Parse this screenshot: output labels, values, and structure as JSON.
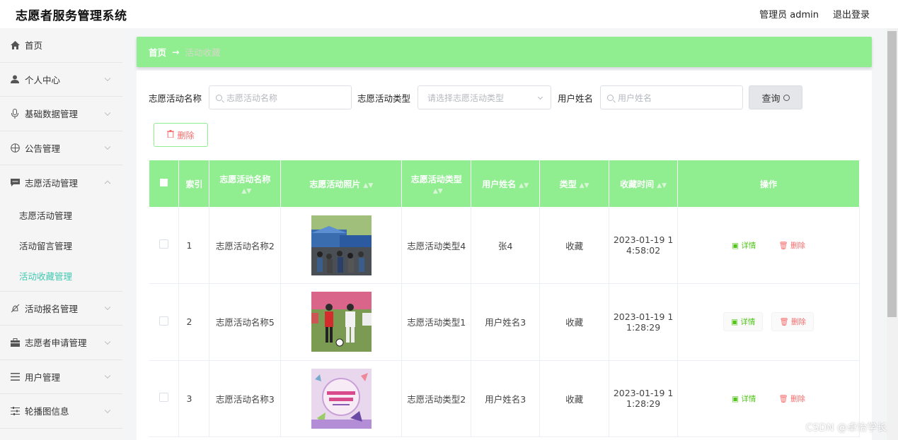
{
  "app": {
    "title": "志愿者服务管理系统",
    "user_label": "管理员 admin",
    "logout_label": "退出登录"
  },
  "sidebar": {
    "items": [
      {
        "label": "首页",
        "icon": "home-icon"
      },
      {
        "label": "个人中心",
        "icon": "user-icon"
      },
      {
        "label": "基础数据管理",
        "icon": "mic-icon"
      },
      {
        "label": "公告管理",
        "icon": "compass-icon"
      },
      {
        "label": "志愿活动管理",
        "icon": "chat-icon"
      },
      {
        "label": "活动报名管理",
        "icon": "bell-off-icon"
      },
      {
        "label": "志愿者申请管理",
        "icon": "briefcase-icon"
      },
      {
        "label": "用户管理",
        "icon": "menu-icon"
      },
      {
        "label": "轮播图信息",
        "icon": "sliders-icon"
      }
    ],
    "submenu": [
      {
        "label": "志愿活动管理"
      },
      {
        "label": "活动留言管理"
      },
      {
        "label": "活动收藏管理"
      }
    ]
  },
  "breadcrumb": {
    "home": "首页",
    "separator": "→",
    "current": "活动收藏"
  },
  "filters": {
    "name_label": "志愿活动名称",
    "name_placeholder": "志愿活动名称",
    "type_label": "志愿活动类型",
    "type_placeholder": "请选择志愿活动类型",
    "user_label": "用户姓名",
    "user_placeholder": "用户姓名",
    "query_label": "查询"
  },
  "toolbar": {
    "delete_label": "删除"
  },
  "table": {
    "headers": [
      "索引",
      "志愿活动名称",
      "志愿活动照片",
      "志愿活动类型",
      "用户姓名",
      "类型",
      "收藏时间",
      "操作"
    ],
    "rows": [
      {
        "index": "1",
        "name": "志愿活动名称2",
        "type": "志愿活动类型4",
        "user": "张4",
        "kind": "收藏",
        "time": "2023-01-19 14:58:02",
        "time_l1": "2023-01-19 1",
        "time_l2": "4:58:02"
      },
      {
        "index": "2",
        "name": "志愿活动名称5",
        "type": "志愿活动类型1",
        "user": "用户姓名3",
        "kind": "收藏",
        "time": "2023-01-19 11:28:29",
        "time_l1": "2023-01-19 1",
        "time_l2": "1:28:29"
      },
      {
        "index": "3",
        "name": "志愿活动名称3",
        "type": "志愿活动类型2",
        "user": "用户姓名3",
        "kind": "收藏",
        "time": "2023-01-19 11:28:29",
        "time_l1": "2023-01-19 1",
        "time_l2": "1:28:29"
      }
    ],
    "detail_label": "详情",
    "delete_label": "删除"
  },
  "watermark": "CSDN @卓怡学长",
  "colors": {
    "accent": "#90ee90",
    "active_text": "#40c9b0",
    "danger": "#f56c6c",
    "success": "#52c41a"
  }
}
